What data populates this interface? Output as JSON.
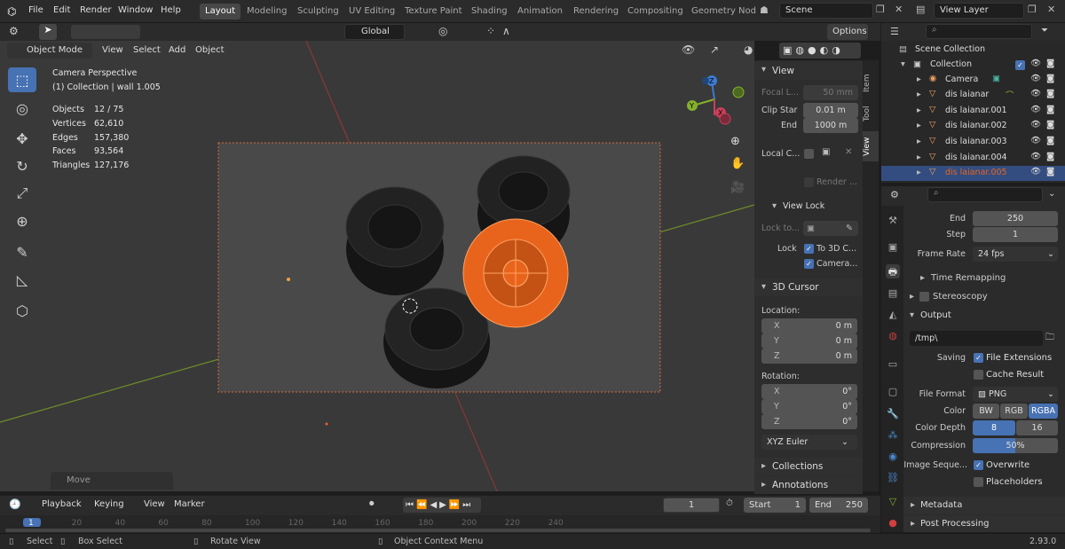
{
  "topbar": {
    "menus": [
      "File",
      "Edit",
      "Render",
      "Window",
      "Help"
    ],
    "workspaces": [
      "Layout",
      "Modeling",
      "Sculpting",
      "UV Editing",
      "Texture Paint",
      "Shading",
      "Animation",
      "Rendering",
      "Compositing",
      "Geometry Nod"
    ],
    "scene": "Scene",
    "view_layer": "View Layer"
  },
  "viewport_header": {
    "mode": "Object Mode",
    "menus": [
      "View",
      "Select",
      "Add",
      "Object"
    ],
    "transform": "Global",
    "options": "Options"
  },
  "viewport": {
    "title": "Camera Perspective",
    "subtitle": "(1) Collection | wall 1.005",
    "stats": [
      {
        "label": "Objects",
        "value": "12 / 75"
      },
      {
        "label": "Vertices",
        "value": "62,610"
      },
      {
        "label": "Edges",
        "value": "157,380"
      },
      {
        "label": "Faces",
        "value": "93,564"
      },
      {
        "label": "Triangles",
        "value": "127,176"
      }
    ],
    "last_op": "Move",
    "gizmo": {
      "x": "X",
      "y": "Y",
      "z": "Z"
    }
  },
  "npanel": {
    "view_header": "View",
    "focal_label": "Focal L...",
    "focal_value": "50 mm",
    "clip_start_label": "Clip Star",
    "clip_start_value": "0.01 m",
    "clip_end_label": "End",
    "clip_end_value": "1000 m",
    "local_camera_label": "Local C...",
    "render_region": "Render ...",
    "view_lock_header": "View Lock",
    "lock_to_label": "Lock to...",
    "lock_label": "Lock",
    "lock_3d_cursor": "To 3D C...",
    "lock_camera": "Camera...",
    "cursor_header": "3D Cursor",
    "location_label": "Location:",
    "location": [
      {
        "axis": "X",
        "value": "0 m"
      },
      {
        "axis": "Y",
        "value": "0 m"
      },
      {
        "axis": "Z",
        "value": "0 m"
      }
    ],
    "rotation_label": "Rotation:",
    "rotation": [
      {
        "axis": "X",
        "value": "0°"
      },
      {
        "axis": "Y",
        "value": "0°"
      },
      {
        "axis": "Z",
        "value": "0°"
      }
    ],
    "rotation_mode": "XYZ Euler",
    "collections_header": "Collections",
    "annotations_header": "Annotations",
    "tabs": [
      "Item",
      "Tool",
      "View"
    ]
  },
  "outliner": {
    "root": "Scene Collection",
    "collection": "Collection",
    "items": [
      {
        "name": "Camera",
        "kind": "camera"
      },
      {
        "name": "dis laianar",
        "kind": "mesh"
      },
      {
        "name": "dis laianar.001",
        "kind": "mesh"
      },
      {
        "name": "dis laianar.002",
        "kind": "mesh"
      },
      {
        "name": "dis laianar.003",
        "kind": "mesh"
      },
      {
        "name": "dis laianar.004",
        "kind": "mesh"
      },
      {
        "name": "dis laianar.005",
        "kind": "mesh",
        "selected": true
      }
    ]
  },
  "properties": {
    "end_label": "End",
    "end_value": "250",
    "step_label": "Step",
    "step_value": "1",
    "frame_rate_label": "Frame Rate",
    "frame_rate_value": "24 fps",
    "time_remapping": "Time Remapping",
    "stereoscopy": "Stereoscopy",
    "output_header": "Output",
    "output_path": "/tmp\\",
    "saving_label": "Saving",
    "file_extensions": "File Extensions",
    "cache_result": "Cache Result",
    "file_format_label": "File Format",
    "file_format_value": "PNG",
    "color_label": "Color",
    "color_options": [
      "BW",
      "RGB",
      "RGBA"
    ],
    "color_depth_label": "Color Depth",
    "color_depth_options": [
      "8",
      "16"
    ],
    "compression_label": "Compression",
    "compression_value": "50%",
    "compression_fraction": 0.5,
    "image_seq_label": "Image Seque...",
    "overwrite": "Overwrite",
    "placeholders": "Placeholders",
    "metadata_header": "Metadata",
    "post_processing_header": "Post Processing"
  },
  "timeline": {
    "menus": [
      "Playback",
      "Keying",
      "View",
      "Marker"
    ],
    "current_frame": "1",
    "start_label": "Start",
    "start_value": "1",
    "end_label": "End",
    "end_value": "250",
    "ruler": [
      "1",
      "20",
      "40",
      "60",
      "80",
      "100",
      "120",
      "140",
      "160",
      "180",
      "200",
      "220",
      "240"
    ]
  },
  "statusbar": {
    "select": "Select",
    "box_select": "Box Select",
    "rotate_view": "Rotate View",
    "context_menu": "Object Context Menu",
    "version": "2.93.0"
  },
  "colors": {
    "accent": "#4772b3",
    "selected_orange": "#e8641c",
    "background": "#393939"
  }
}
